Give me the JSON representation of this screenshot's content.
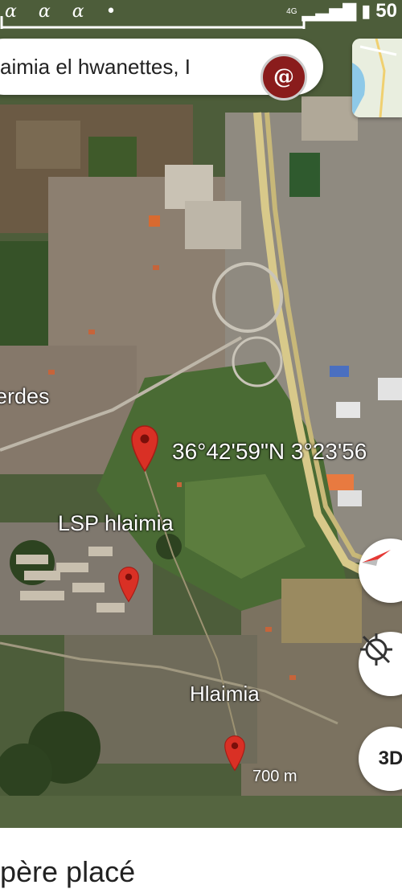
{
  "status_bar": {
    "left_icons": "ɑ ɑ ɑ •",
    "network": "4G",
    "battery": "50"
  },
  "search": {
    "query": "aimia el hwanettes, I"
  },
  "account": {
    "avatar_letter": "@"
  },
  "map": {
    "coordinates_label": "36°42'59\"N 3°23'56",
    "place_lsp": "LSP hlaimia",
    "place_town": "Hlaimia",
    "place_left": "erdes",
    "scale_label": "700 m",
    "pins": [
      "coordinate-pin",
      "lsp-pin",
      "town-pin"
    ]
  },
  "controls": {
    "three_d": "3D",
    "compass_icon": "compass-icon",
    "location_icon": "location-off-icon"
  },
  "bottom_sheet": {
    "title": "père placé"
  }
}
